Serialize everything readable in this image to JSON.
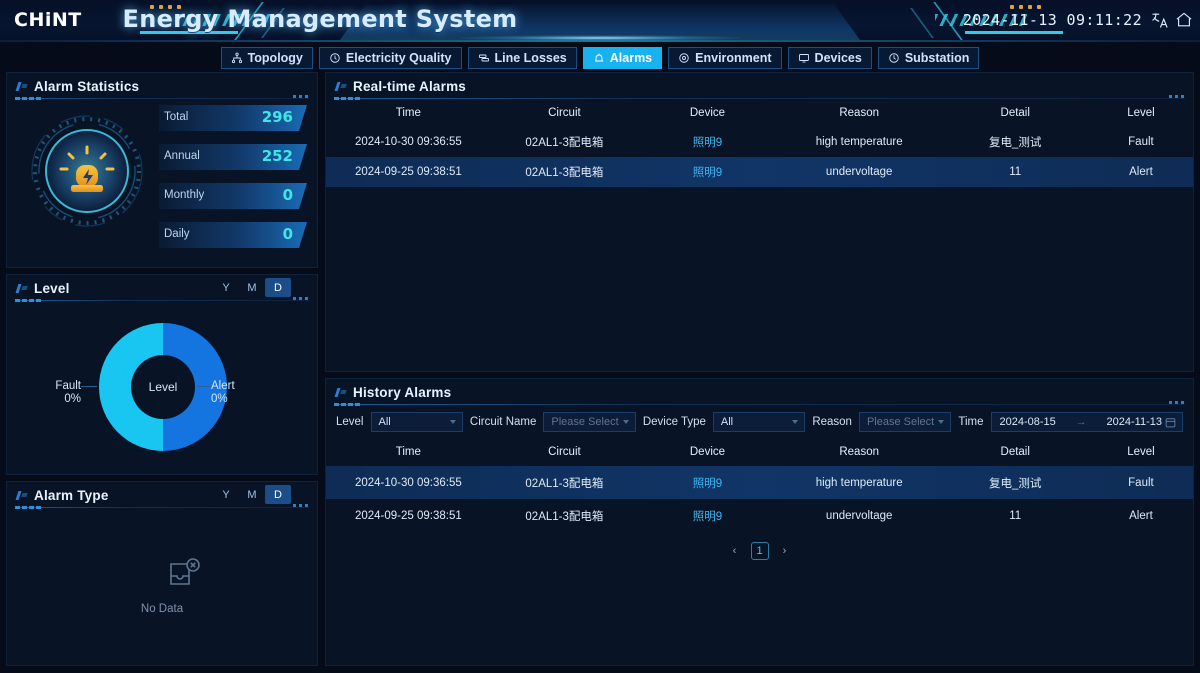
{
  "header": {
    "logo": "CHiNT",
    "title": "Energy Management System",
    "datetime": "2024-11-13 09:11:22",
    "lang_icon": "language-icon",
    "home_icon": "home-icon"
  },
  "nav": {
    "tabs": [
      {
        "label": "Topology",
        "icon": "topology-icon",
        "active": false
      },
      {
        "label": "Electricity Quality",
        "icon": "gauge-icon",
        "active": false
      },
      {
        "label": "Line Losses",
        "icon": "line-losses-icon",
        "active": false
      },
      {
        "label": "Alarms",
        "icon": "alarm-bell-icon",
        "active": true
      },
      {
        "label": "Environment",
        "icon": "environment-icon",
        "active": false
      },
      {
        "label": "Devices",
        "icon": "monitor-icon",
        "active": false
      },
      {
        "label": "Substation",
        "icon": "substation-icon",
        "active": false
      }
    ]
  },
  "alarm_statistics": {
    "title": "Alarm Statistics",
    "icon": "alarm-beacon-icon",
    "items": [
      {
        "label": "Total",
        "value": "296"
      },
      {
        "label": "Annual",
        "value": "252"
      },
      {
        "label": "Monthly",
        "value": "0"
      },
      {
        "label": "Daily",
        "value": "0"
      }
    ]
  },
  "level_panel": {
    "title": "Level",
    "range_options": [
      "Y",
      "M",
      "D"
    ],
    "selected_range": "D",
    "center_label": "Level",
    "chart_data": {
      "type": "pie",
      "title": "Level",
      "categories": [
        "Fault",
        "Alert"
      ],
      "values": [
        0,
        0
      ],
      "display_percents": [
        "0%",
        "0%"
      ],
      "colors": [
        "#19c6f2",
        "#1474e0"
      ],
      "legend_position": "outside-labels",
      "labels": [
        {
          "name": "Fault",
          "percent": "0%",
          "side": "left"
        },
        {
          "name": "Alert",
          "percent": "0%",
          "side": "right"
        }
      ]
    }
  },
  "alarm_type_panel": {
    "title": "Alarm Type",
    "range_options": [
      "Y",
      "M",
      "D"
    ],
    "selected_range": "D",
    "empty_icon": "no-data-icon",
    "empty_text": "No Data"
  },
  "realtime_alarms": {
    "title": "Real-time Alarms",
    "columns": [
      "Time",
      "Circuit",
      "Device",
      "Reason",
      "Detail",
      "Level"
    ],
    "rows": [
      {
        "time": "2024-10-30 09:36:55",
        "circuit": "02AL1-3配电箱",
        "device": "照明9",
        "reason": "high temperature",
        "detail": "复电_测试",
        "level": "Fault",
        "level_kind": "fault",
        "highlight": false
      },
      {
        "time": "2024-09-25 09:38:51",
        "circuit": "02AL1-3配电箱",
        "device": "照明9",
        "reason": "undervoltage",
        "detail": "11",
        "level": "Alert",
        "level_kind": "alert",
        "highlight": true
      }
    ]
  },
  "history_alarms": {
    "title": "History Alarms",
    "filters": {
      "level_label": "Level",
      "level_value": "All",
      "circuit_label": "Circuit Name",
      "circuit_placeholder": "Please Select",
      "device_type_label": "Device Type",
      "device_type_value": "All",
      "reason_label": "Reason",
      "reason_placeholder": "Please Select",
      "time_label": "Time",
      "date_start": "2024-08-15",
      "date_arrow": "→",
      "date_end": "2024-11-13",
      "calendar_icon": "calendar-icon"
    },
    "columns": [
      "Time",
      "Circuit",
      "Device",
      "Reason",
      "Detail",
      "Level"
    ],
    "rows": [
      {
        "time": "2024-10-30 09:36:55",
        "circuit": "02AL1-3配电箱",
        "device": "照明9",
        "reason": "high temperature",
        "detail": "复电_测试",
        "level": "Fault",
        "level_kind": "fault",
        "highlight": true
      },
      {
        "time": "2024-09-25 09:38:51",
        "circuit": "02AL1-3配电箱",
        "device": "照明9",
        "reason": "undervoltage",
        "detail": "11",
        "level": "Alert",
        "level_kind": "alert",
        "highlight": false
      }
    ],
    "pagination": {
      "prev": "‹",
      "current": "1",
      "next": "›"
    }
  },
  "colors": {
    "accent_cyan": "#18b3ef",
    "fault_red": "#f0483f",
    "alert_yellow": "#e4c21c",
    "link_blue": "#3fb6ef",
    "panel_bg": "#091326"
  }
}
